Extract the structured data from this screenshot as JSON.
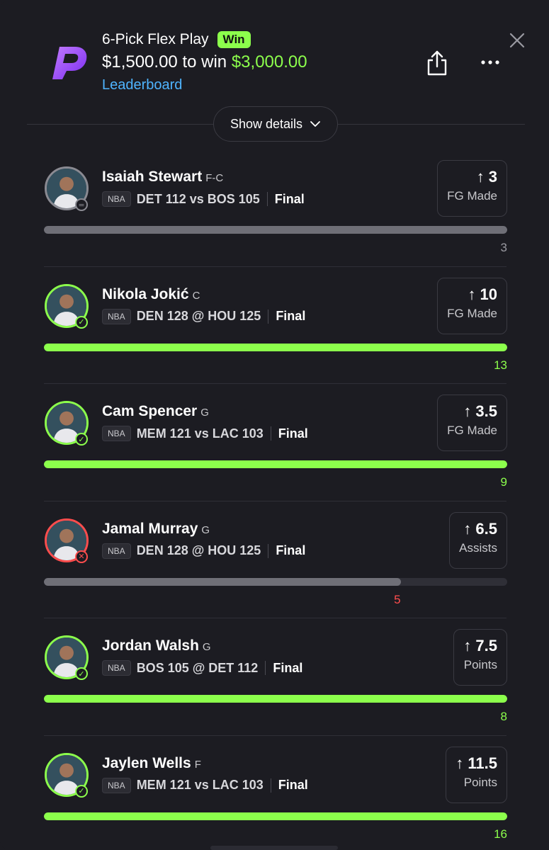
{
  "header": {
    "title": "6-Pick Flex Play",
    "badge": "Win",
    "stake": "$1,500.00",
    "to_win_text": "to win",
    "payout": "$3,000.00",
    "leaderboard_label": "Leaderboard",
    "details_label": "Show details",
    "colors": {
      "accent": "#8cff4c",
      "link": "#4fb4ff",
      "background": "#1c1c22",
      "loss": "#ff4d4d"
    }
  },
  "picks": [
    {
      "name": "Isaiah Stewart",
      "position": "F-C",
      "league": "NBA",
      "matchup": "DET 112 vs BOS 105",
      "status": "Final",
      "line": "3",
      "stat": "FG Made",
      "actual": "3",
      "result": "push",
      "progress": 1.0
    },
    {
      "name": "Nikola Jokić",
      "position": "C",
      "league": "NBA",
      "matchup": "DEN 128 @ HOU 125",
      "status": "Final",
      "line": "10",
      "stat": "FG Made",
      "actual": "13",
      "result": "win",
      "progress": 1.0
    },
    {
      "name": "Cam Spencer",
      "position": "G",
      "league": "NBA",
      "matchup": "MEM 121 vs LAC 103",
      "status": "Final",
      "line": "3.5",
      "stat": "FG Made",
      "actual": "9",
      "result": "win",
      "progress": 1.0
    },
    {
      "name": "Jamal Murray",
      "position": "G",
      "league": "NBA",
      "matchup": "DEN 128 @ HOU 125",
      "status": "Final",
      "line": "6.5",
      "stat": "Assists",
      "actual": "5",
      "result": "loss",
      "progress": 0.77
    },
    {
      "name": "Jordan Walsh",
      "position": "G",
      "league": "NBA",
      "matchup": "BOS 105 @ DET 112",
      "status": "Final",
      "line": "7.5",
      "stat": "Points",
      "actual": "8",
      "result": "win",
      "progress": 1.0
    },
    {
      "name": "Jaylen Wells",
      "position": "F",
      "league": "NBA",
      "matchup": "MEM 121 vs LAC 103",
      "status": "Final",
      "line": "11.5",
      "stat": "Points",
      "actual": "16",
      "result": "win",
      "progress": 1.0
    }
  ]
}
